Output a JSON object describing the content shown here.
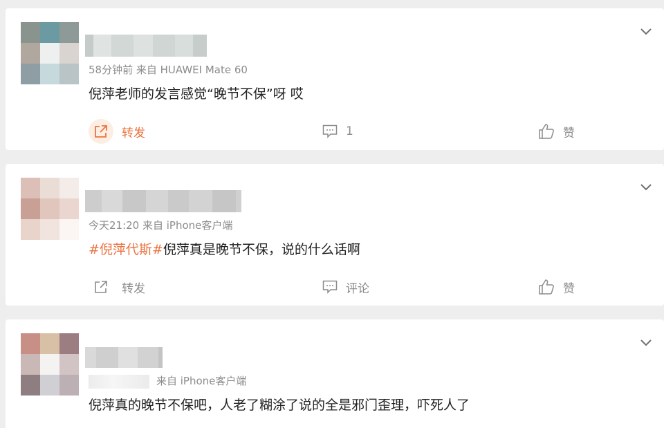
{
  "posts": [
    {
      "meta": "58分钟前  来自 HUAWEI Mate 60",
      "content": "倪萍老师的发言感觉“晚节不保”呀 哎",
      "hashtag": "",
      "repost_label": "转发",
      "comment_label": "1",
      "like_label": "赞",
      "repost_active": true
    },
    {
      "meta": "今天21:20  来自 iPhone客户端",
      "hashtag": "#倪萍代斯#",
      "content": "倪萍真是晚节不保，说的什么话啊",
      "repost_label": "转发",
      "comment_label": "评论",
      "like_label": "赞",
      "repost_active": false
    },
    {
      "meta": "来自 iPhone客户端",
      "hashtag": "",
      "content": "倪萍真的晚节不保吧，人老了糊涂了说的全是邪门歪理，吓死人了",
      "repost_label": "",
      "comment_label": "",
      "like_label": "",
      "repost_active": false
    }
  ],
  "colors": {
    "accent": "#eb7340",
    "meta": "#8c8c8c",
    "card_bg": "#ffffff",
    "page_bg": "#eeeeee"
  },
  "icons": {
    "more": "chevron-down-icon",
    "repost": "repost-icon",
    "comment": "comment-icon",
    "like": "thumbs-up-icon"
  }
}
